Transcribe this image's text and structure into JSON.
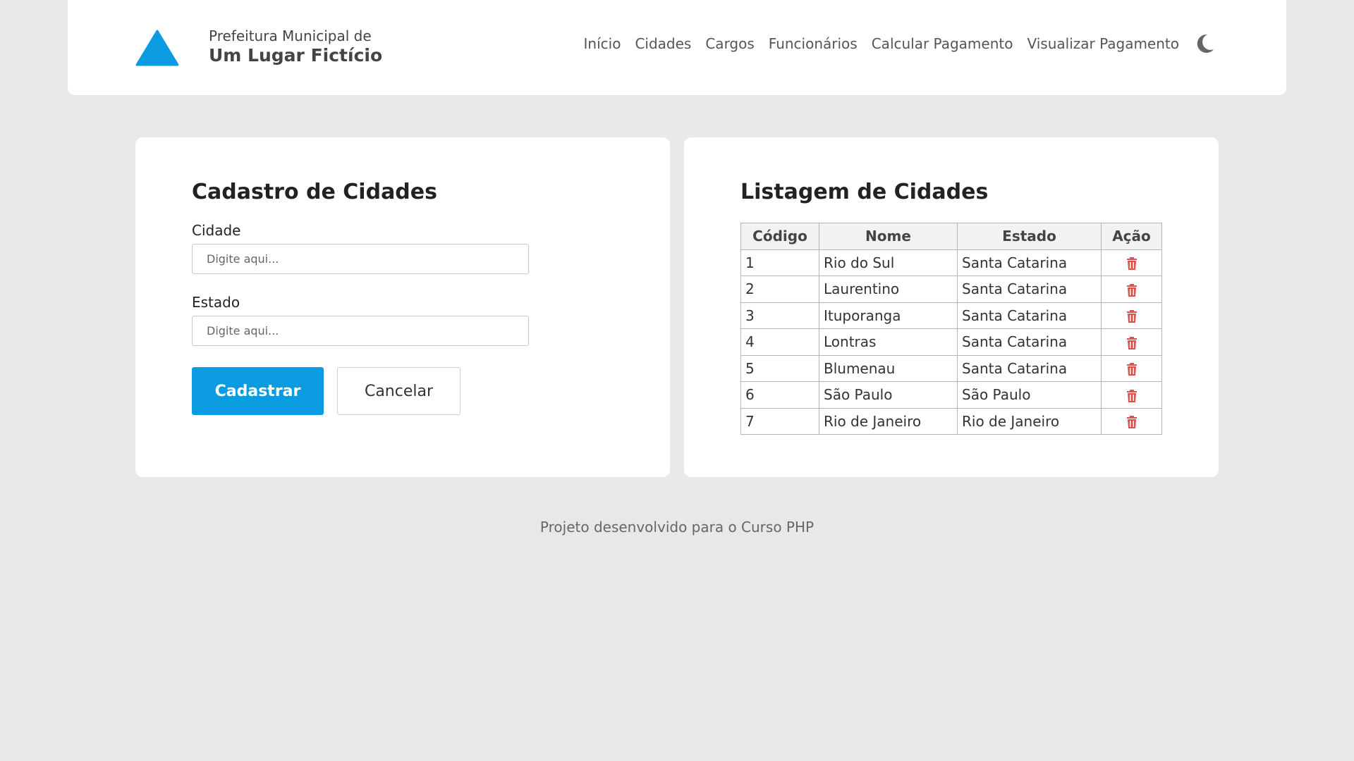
{
  "brand": {
    "line1": "Prefeitura Municipal de",
    "line2": "Um Lugar Fictício",
    "logo_icon": "triangle-logo-icon",
    "logo_color": "#0b9be0"
  },
  "nav": {
    "items": [
      "Início",
      "Cidades",
      "Cargos",
      "Funcionários",
      "Calcular Pagamento",
      "Visualizar Pagamento"
    ],
    "theme_toggle_icon": "moon-icon"
  },
  "form": {
    "title": "Cadastro de Cidades",
    "city_label": "Cidade",
    "city_placeholder": "Digite aqui...",
    "city_value": "",
    "state_label": "Estado",
    "state_placeholder": "Digite aqui...",
    "state_value": "",
    "submit_label": "Cadastrar",
    "cancel_label": "Cancelar"
  },
  "listing": {
    "title": "Listagem de Cidades",
    "headers": [
      "Código",
      "Nome",
      "Estado",
      "Ação"
    ],
    "rows": [
      {
        "code": "1",
        "name": "Rio do Sul",
        "state": "Santa Catarina"
      },
      {
        "code": "2",
        "name": "Laurentino",
        "state": "Santa Catarina"
      },
      {
        "code": "3",
        "name": "Ituporanga",
        "state": "Santa Catarina"
      },
      {
        "code": "4",
        "name": "Lontras",
        "state": "Santa Catarina"
      },
      {
        "code": "5",
        "name": "Blumenau",
        "state": "Santa Catarina"
      },
      {
        "code": "6",
        "name": "São Paulo",
        "state": "São Paulo"
      },
      {
        "code": "7",
        "name": "Rio de Janeiro",
        "state": "Rio de Janeiro"
      }
    ],
    "action_icon": "trash-icon",
    "action_color": "#d9534f"
  },
  "footer": {
    "text": "Projeto desenvolvido para o Curso PHP"
  },
  "colors": {
    "background": "#e8e8e8",
    "primary": "#0b9be0",
    "surface": "#ffffff"
  }
}
